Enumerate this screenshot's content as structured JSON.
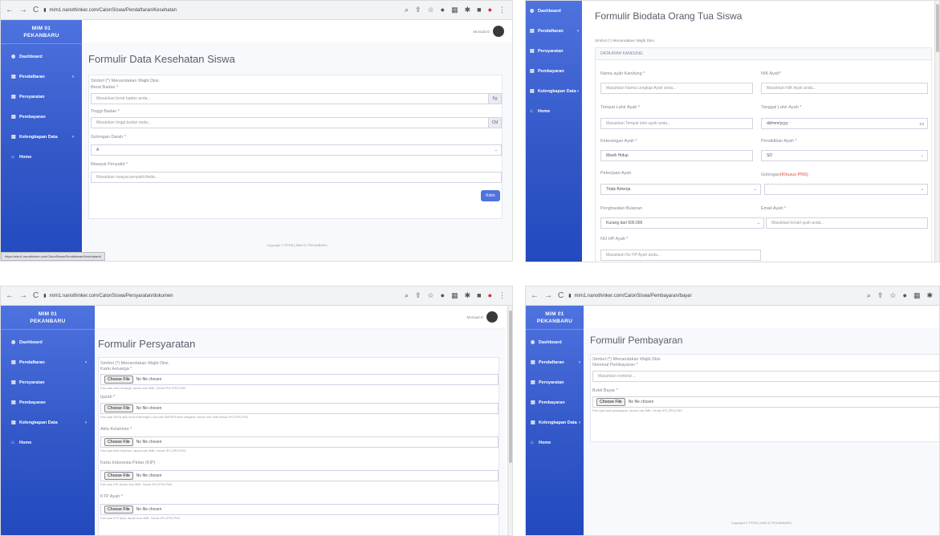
{
  "browser": {
    "url_health": "mim1.nanothinker.com/CalonSiswa/Pendaftaran/Kesehatan",
    "url_docs": "mim1.nanothinker.com/CalonSiswa/Persyaratan/dokumen",
    "url_payment": "mim1.nanothinker.com/CalonSiswa/Pembayaran/bayar",
    "status_link": "https://mim1.nanothinker.com/CalonSiswa/Pendaftaran/Kesehatan#"
  },
  "brand": {
    "line1": "MIM 01",
    "line2": "PEKANBARU"
  },
  "sidebar": {
    "items": [
      {
        "label": "Dashboard",
        "icon": "tachometer-icon"
      },
      {
        "label": "Pendaftaran",
        "icon": "form-icon",
        "chevron": "›"
      },
      {
        "label": "Persyaratan",
        "icon": "form-icon"
      },
      {
        "label": "Pembayaran",
        "icon": "form-icon"
      },
      {
        "label": "Kelengkapan Data",
        "icon": "form-icon",
        "chevron": "›"
      },
      {
        "label": "Home",
        "icon": "home-icon"
      }
    ]
  },
  "user": {
    "name": "Mursaid D"
  },
  "footer": {
    "copyright": "Copyright © PPDB | MIM 01 PEKANBARU"
  },
  "required_note": "Simbol (*) Menandakan Wajib Diisi.",
  "health_form": {
    "title": "Formulir Data Kesehatan Siswa",
    "weight_label": "Berat Badan *",
    "weight_placeholder": "Masukkan berat badan anda...",
    "weight_unit": "Kg",
    "height_label": "Tinggi Badan *",
    "height_placeholder": "Masukkan tinggi badan anda...",
    "height_unit": "CM",
    "blood_label": "Golongan Darah *",
    "blood_value": "A",
    "history_label": "Riwayat Penyakit *",
    "history_placeholder": "Masukkan riwayat penyakit Anda...",
    "submit_label": "Kirim"
  },
  "parent_form": {
    "title": "Formulir Biodata Orang Tua Siswa",
    "section": "DATA AYAH KANDUNG",
    "name_label": "Nama ayah Kandung *",
    "name_placeholder": "Masukkan Nama Lengkap Ayah anda...",
    "nik_label": "NIK Ayah*",
    "nik_placeholder": "Masukkan NIK Ayah anda...",
    "birthplace_label": "Tempat Lahir Ayah *",
    "birthplace_placeholder": "Masukkan Tempat lahir ayah anda...",
    "birthdate_label": "Tanggal Lahir Ayah *",
    "birthdate_placeholder": "dd/mm/yyyy",
    "status_label": "Keterangan Ayah *",
    "status_value": "Masih Hidup",
    "education_label": "Pendidikan Ayah *",
    "education_value": "SD",
    "job_label": "Pekerjaan Ayah",
    "job_value": "Tidak Bekerja",
    "rank_label": "Golongan",
    "rank_note": "(Khusus PNS)",
    "rank_value": "-",
    "income_label": "Penghasilan Bulanan",
    "income_value": "Kurang dari 500.000",
    "email_label": "Email Ayah *",
    "email_placeholder": "Masukkan Email ayah anda...",
    "phone_label": "NO HP Ayah *",
    "phone_placeholder": "Masukkan No HP Ayah anda..."
  },
  "docs_form": {
    "title": "Formulir Persyaratan",
    "choose_label": "Choose File",
    "no_file": "No file chosen",
    "fields": [
      {
        "label": "Kartu keluarga *",
        "hint": "Foto scan kartu keluarga. ukuran max 3MB , format JPG,JPEG,PNG"
      },
      {
        "label": "Ijazah *",
        "hint": "Foto scan SHUN atau Surat Keterangan Lulus dari SMP/MTs telah dilegalisir. ukuran max 3MB format JPG,JPEG,PNG"
      },
      {
        "label": "Akta Kelahiran *",
        "hint": "Foto scan Akta Kelahiran. ukuran max 3MB , format JPG,JPEG,PNG"
      },
      {
        "label": "Kartu Indonesia Pintar (KIP)",
        "hint": "Foto scan KIP. ukuran max 3MB , format JPG,JPEG,PNG"
      },
      {
        "label": "KTP Ayah *",
        "hint": "Foto scan KTP Ayah. ukuran max 3MB , format JPG,JPEG,PNG"
      }
    ]
  },
  "payment_form": {
    "title": "Formulir Pembayaran",
    "amount_label": "Nominal Pembayaran *",
    "amount_placeholder": "Masukkan nominal ...",
    "proof_label": "Bukti Bayar *",
    "choose_label": "Choose File",
    "no_file": "No file chosen",
    "proof_hint": "Foto scan bukti pembayaran. ukuran max 3MB , format JPG,JPEG,PNG"
  },
  "icons": {
    "back": "←",
    "forward": "→",
    "reload": "C",
    "lock": "🔒",
    "zoom": "🔍",
    "share": "⇪",
    "star": "☆"
  }
}
